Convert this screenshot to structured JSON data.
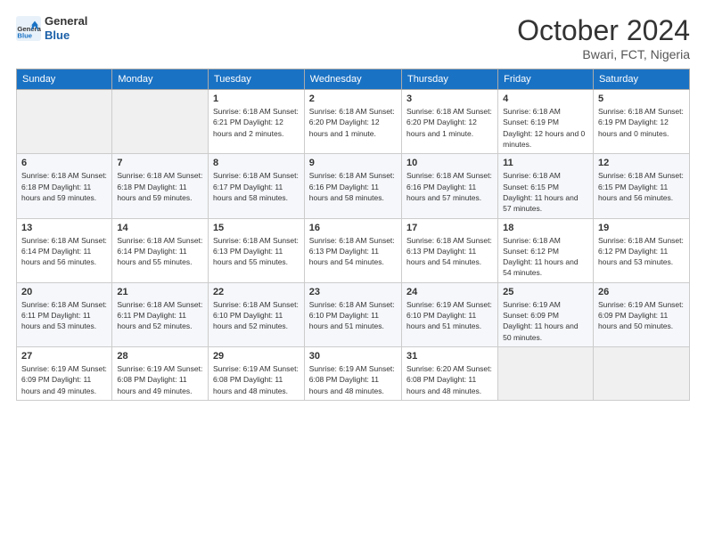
{
  "header": {
    "logo_general": "General",
    "logo_blue": "Blue",
    "title": "October 2024",
    "location": "Bwari, FCT, Nigeria"
  },
  "weekdays": [
    "Sunday",
    "Monday",
    "Tuesday",
    "Wednesday",
    "Thursday",
    "Friday",
    "Saturday"
  ],
  "weeks": [
    [
      {
        "day": "",
        "info": ""
      },
      {
        "day": "",
        "info": ""
      },
      {
        "day": "1",
        "info": "Sunrise: 6:18 AM\nSunset: 6:21 PM\nDaylight: 12 hours\nand 2 minutes."
      },
      {
        "day": "2",
        "info": "Sunrise: 6:18 AM\nSunset: 6:20 PM\nDaylight: 12 hours\nand 1 minute."
      },
      {
        "day": "3",
        "info": "Sunrise: 6:18 AM\nSunset: 6:20 PM\nDaylight: 12 hours\nand 1 minute."
      },
      {
        "day": "4",
        "info": "Sunrise: 6:18 AM\nSunset: 6:19 PM\nDaylight: 12 hours\nand 0 minutes."
      },
      {
        "day": "5",
        "info": "Sunrise: 6:18 AM\nSunset: 6:19 PM\nDaylight: 12 hours\nand 0 minutes."
      }
    ],
    [
      {
        "day": "6",
        "info": "Sunrise: 6:18 AM\nSunset: 6:18 PM\nDaylight: 11 hours\nand 59 minutes."
      },
      {
        "day": "7",
        "info": "Sunrise: 6:18 AM\nSunset: 6:18 PM\nDaylight: 11 hours\nand 59 minutes."
      },
      {
        "day": "8",
        "info": "Sunrise: 6:18 AM\nSunset: 6:17 PM\nDaylight: 11 hours\nand 58 minutes."
      },
      {
        "day": "9",
        "info": "Sunrise: 6:18 AM\nSunset: 6:16 PM\nDaylight: 11 hours\nand 58 minutes."
      },
      {
        "day": "10",
        "info": "Sunrise: 6:18 AM\nSunset: 6:16 PM\nDaylight: 11 hours\nand 57 minutes."
      },
      {
        "day": "11",
        "info": "Sunrise: 6:18 AM\nSunset: 6:15 PM\nDaylight: 11 hours\nand 57 minutes."
      },
      {
        "day": "12",
        "info": "Sunrise: 6:18 AM\nSunset: 6:15 PM\nDaylight: 11 hours\nand 56 minutes."
      }
    ],
    [
      {
        "day": "13",
        "info": "Sunrise: 6:18 AM\nSunset: 6:14 PM\nDaylight: 11 hours\nand 56 minutes."
      },
      {
        "day": "14",
        "info": "Sunrise: 6:18 AM\nSunset: 6:14 PM\nDaylight: 11 hours\nand 55 minutes."
      },
      {
        "day": "15",
        "info": "Sunrise: 6:18 AM\nSunset: 6:13 PM\nDaylight: 11 hours\nand 55 minutes."
      },
      {
        "day": "16",
        "info": "Sunrise: 6:18 AM\nSunset: 6:13 PM\nDaylight: 11 hours\nand 54 minutes."
      },
      {
        "day": "17",
        "info": "Sunrise: 6:18 AM\nSunset: 6:13 PM\nDaylight: 11 hours\nand 54 minutes."
      },
      {
        "day": "18",
        "info": "Sunrise: 6:18 AM\nSunset: 6:12 PM\nDaylight: 11 hours\nand 54 minutes."
      },
      {
        "day": "19",
        "info": "Sunrise: 6:18 AM\nSunset: 6:12 PM\nDaylight: 11 hours\nand 53 minutes."
      }
    ],
    [
      {
        "day": "20",
        "info": "Sunrise: 6:18 AM\nSunset: 6:11 PM\nDaylight: 11 hours\nand 53 minutes."
      },
      {
        "day": "21",
        "info": "Sunrise: 6:18 AM\nSunset: 6:11 PM\nDaylight: 11 hours\nand 52 minutes."
      },
      {
        "day": "22",
        "info": "Sunrise: 6:18 AM\nSunset: 6:10 PM\nDaylight: 11 hours\nand 52 minutes."
      },
      {
        "day": "23",
        "info": "Sunrise: 6:18 AM\nSunset: 6:10 PM\nDaylight: 11 hours\nand 51 minutes."
      },
      {
        "day": "24",
        "info": "Sunrise: 6:19 AM\nSunset: 6:10 PM\nDaylight: 11 hours\nand 51 minutes."
      },
      {
        "day": "25",
        "info": "Sunrise: 6:19 AM\nSunset: 6:09 PM\nDaylight: 11 hours\nand 50 minutes."
      },
      {
        "day": "26",
        "info": "Sunrise: 6:19 AM\nSunset: 6:09 PM\nDaylight: 11 hours\nand 50 minutes."
      }
    ],
    [
      {
        "day": "27",
        "info": "Sunrise: 6:19 AM\nSunset: 6:09 PM\nDaylight: 11 hours\nand 49 minutes."
      },
      {
        "day": "28",
        "info": "Sunrise: 6:19 AM\nSunset: 6:08 PM\nDaylight: 11 hours\nand 49 minutes."
      },
      {
        "day": "29",
        "info": "Sunrise: 6:19 AM\nSunset: 6:08 PM\nDaylight: 11 hours\nand 48 minutes."
      },
      {
        "day": "30",
        "info": "Sunrise: 6:19 AM\nSunset: 6:08 PM\nDaylight: 11 hours\nand 48 minutes."
      },
      {
        "day": "31",
        "info": "Sunrise: 6:20 AM\nSunset: 6:08 PM\nDaylight: 11 hours\nand 48 minutes."
      },
      {
        "day": "",
        "info": ""
      },
      {
        "day": "",
        "info": ""
      }
    ]
  ]
}
